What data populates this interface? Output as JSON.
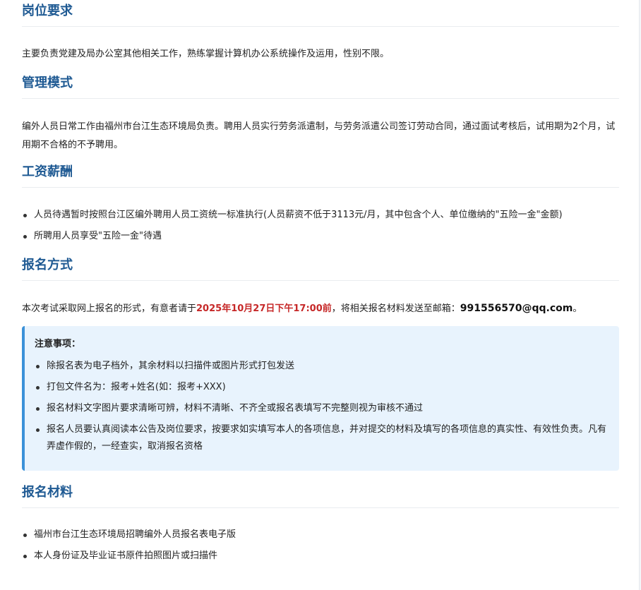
{
  "sections": {
    "requirements": {
      "title": "岗位要求",
      "text": "主要负责党建及局办公室其他相关工作，熟练掌握计算机办公系统操作及运用，性别不限。"
    },
    "management": {
      "title": "管理模式",
      "text": "编外人员日常工作由福州市台江生态环境局负责。聘用人员实行劳务派遣制，与劳务派遣公司签订劳动合同，通过面试考核后，试用期为2个月，试用期不合格的不予聘用。"
    },
    "salary": {
      "title": "工资薪酬",
      "items": [
        "人员待遇暂时按照台江区编外聘用人员工资统一标准执行(人员薪资不低于3113元/月，其中包含个人、单位缴纳的\"五险一金\"金额)",
        "所聘用人员享受\"五险一金\"待遇"
      ]
    },
    "registration": {
      "title": "报名方式",
      "text_before": "本次考试采取网上报名的形式，有意者请于",
      "deadline": "2025年10月27日下午17:00前",
      "text_middle": "，将相关报名材料发送至邮箱：",
      "email": "991556570@qq.com",
      "text_after": "。"
    },
    "notice": {
      "title": "注意事项：",
      "items": [
        "除报名表为电子档外，其余材料以扫描件或图片形式打包发送",
        "打包文件名为：报考+姓名(如：报考+XXX)",
        "报名材料文字图片要求清晰可辨，材料不清晰、不齐全或报名表填写不完整则视为审核不通过",
        "报名人员要认真阅读本公告及岗位要求，按要求如实填写本人的各项信息，并对提交的材料及填写的各项信息的真实性、有效性负责。凡有弄虚作假的，一经查实，取消报名资格"
      ]
    },
    "materials": {
      "title": "报名材料",
      "items": [
        "福州市台江生态环境局招聘编外人员报名表电子版",
        "本人身份证及毕业证书原件拍照图片或扫描件"
      ]
    }
  },
  "colors": {
    "heading": "#1f5a93",
    "deadline": "#c62828",
    "notice_bg": "#e8f3fd",
    "notice_border": "#3b91d8"
  }
}
